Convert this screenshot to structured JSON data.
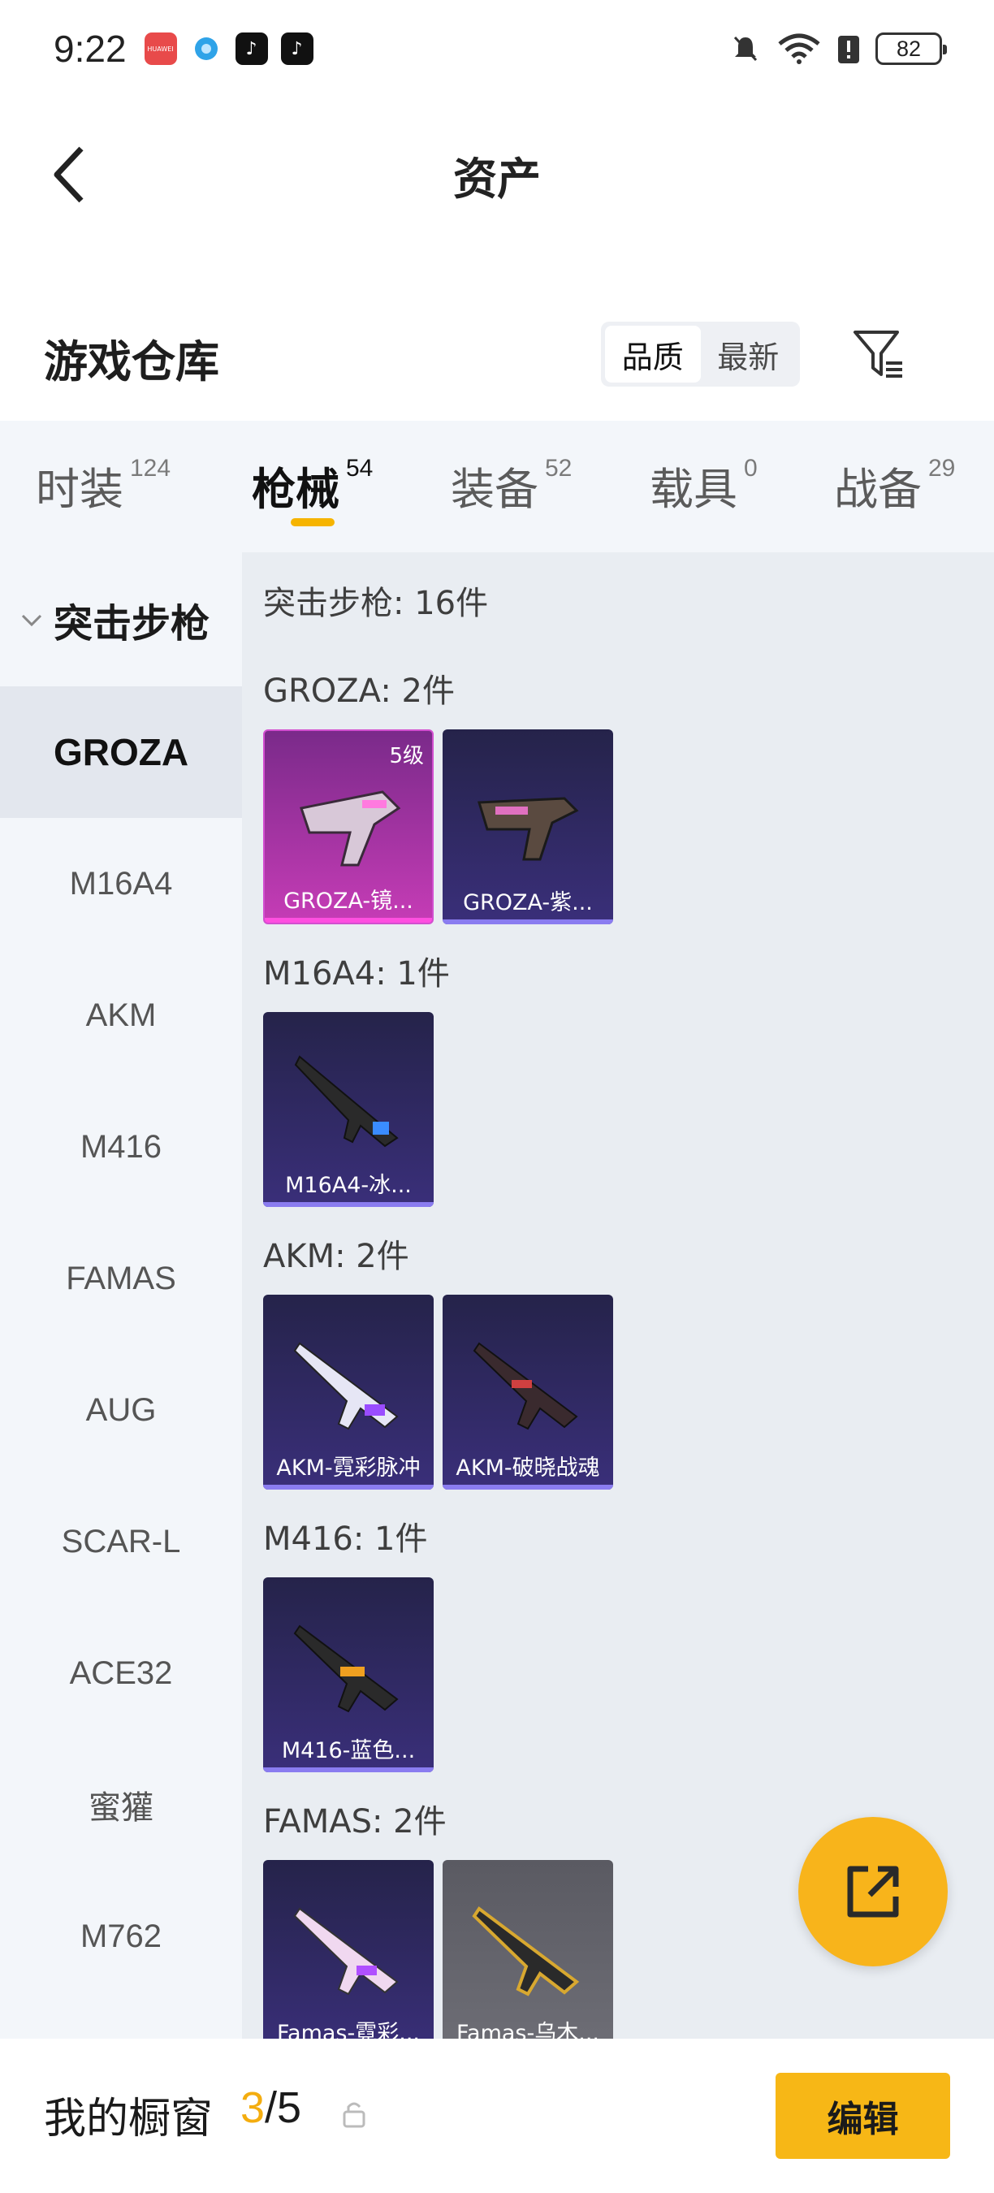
{
  "status_bar": {
    "time": "9:22",
    "notif_label": "HUAWEI",
    "battery": "82"
  },
  "header": {
    "title": "资产"
  },
  "warehouse": {
    "title": "游戏仓库",
    "sort_options": [
      "品质",
      "最新"
    ],
    "active_sort": "品质"
  },
  "tabs": [
    {
      "label": "时装",
      "count": "124"
    },
    {
      "label": "枪械",
      "count": "54"
    },
    {
      "label": "装备",
      "count": "52"
    },
    {
      "label": "载具",
      "count": "0"
    },
    {
      "label": "战备",
      "count": "29"
    }
  ],
  "sidebar": {
    "group": "突击步枪",
    "items": [
      "GROZA",
      "M16A4",
      "AKM",
      "M416",
      "FAMAS",
      "AUG",
      "SCAR-L",
      "ACE32",
      "蜜獾",
      "M762"
    ]
  },
  "content": {
    "summary": "突击步枪: 16件",
    "sections": [
      {
        "title": "GROZA: 2件",
        "cards": [
          {
            "label": "GROZA-镜...",
            "badge": "5级",
            "style": "pink"
          },
          {
            "label": "GROZA-紫...",
            "style": "purple"
          }
        ]
      },
      {
        "title": "M16A4: 1件",
        "cards": [
          {
            "label": "M16A4-冰...",
            "style": "purple"
          }
        ]
      },
      {
        "title": "AKM: 2件",
        "cards": [
          {
            "label": "AKM-霓彩脉冲",
            "style": "purple"
          },
          {
            "label": "AKM-破晓战魂",
            "style": "purple"
          }
        ]
      },
      {
        "title": "M416: 1件",
        "cards": [
          {
            "label": "M416-蓝色...",
            "style": "purple"
          }
        ]
      },
      {
        "title": "FAMAS: 2件",
        "cards": [
          {
            "label": "Famas-霓彩...",
            "style": "purple"
          },
          {
            "label": "Famas-乌木...",
            "style": "gray"
          }
        ]
      }
    ]
  },
  "bottom_bar": {
    "label": "我的橱窗",
    "used": "3",
    "total": "/5",
    "edit_label": "编辑"
  },
  "colors": {
    "accent": "#f7b716",
    "active_tab_underline": "#f6b400"
  }
}
